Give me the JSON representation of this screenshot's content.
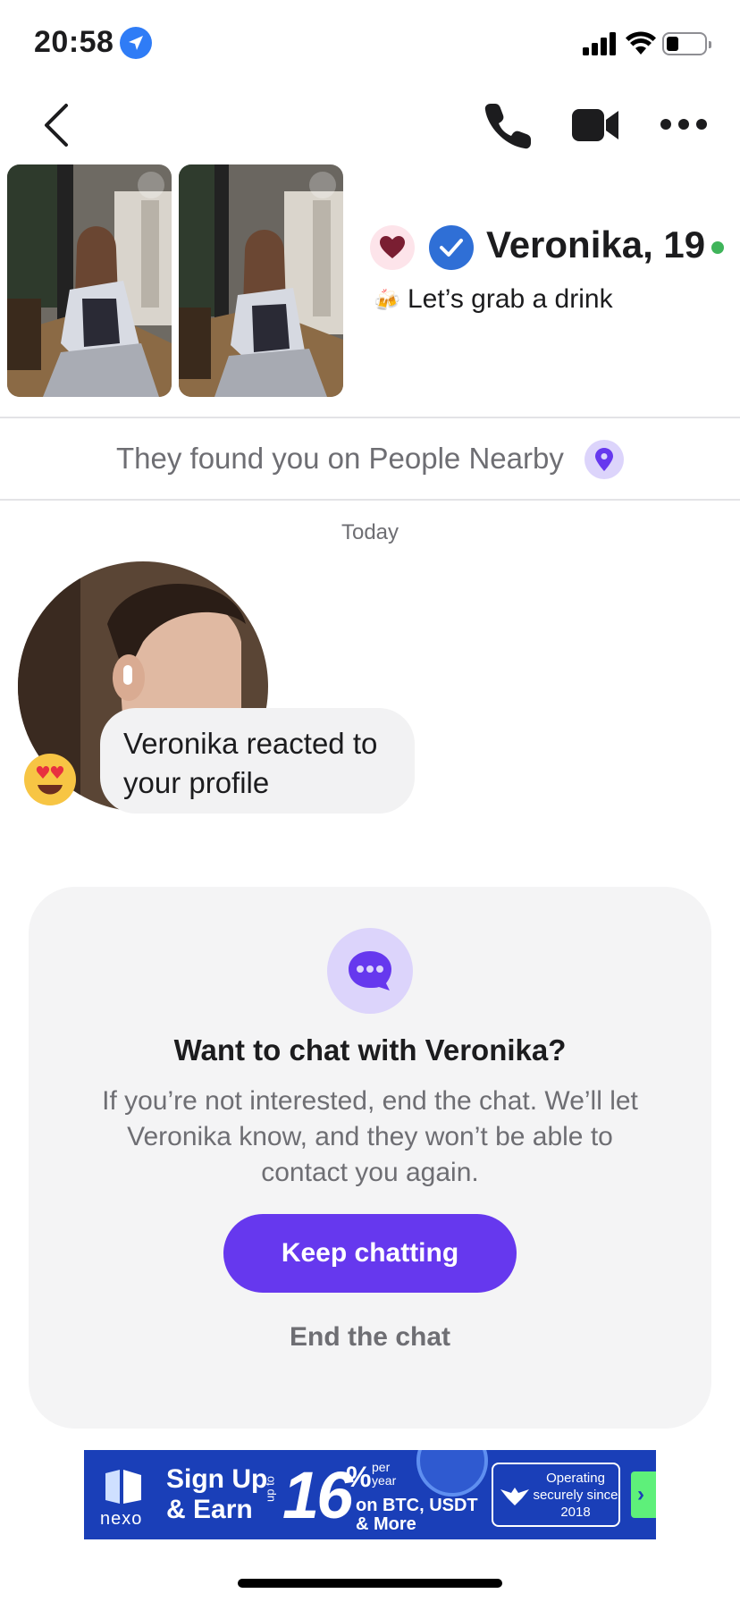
{
  "status_bar": {
    "time": "20:58",
    "icons": [
      "location-arrow-icon",
      "cellular-signal-icon",
      "wifi-icon",
      "battery-icon"
    ]
  },
  "nav": {
    "icons": [
      "chevron-left-icon",
      "phone-icon",
      "video-camera-icon",
      "ellipsis-icon"
    ]
  },
  "profile": {
    "name": "Veronika, 19",
    "status_emoji": "🍻",
    "status_text": "Let’s grab a drink",
    "online": true,
    "online_color": "#3fb45a",
    "photo_count": 2
  },
  "found_banner": {
    "text": "They found you on People Nearby"
  },
  "messages": {
    "date_label": "Today",
    "items": [
      {
        "text": "Veronika reacted to your profile",
        "reaction_emoji": "heart-eyes-emoji"
      }
    ]
  },
  "prompt": {
    "title": "Want to chat with Veronika?",
    "body": "If you’re not interested, end the chat. We’ll let Veronika know, and they won’t be able to contact you again.",
    "primary_label": "Keep chatting",
    "secondary_label": "End the chat"
  },
  "ad": {
    "brand": "nexo",
    "headline": "Sign Up & Earn",
    "up_to": "up to",
    "rate": "16",
    "percent": "%",
    "per_year": "per year",
    "assets": "on BTC, USDT & More",
    "trust": "Operating securely since 2018"
  },
  "colors": {
    "accent": "#6638ee",
    "accent_soft": "#dcd4fb",
    "verified": "#2f6fd6",
    "ad_background": "#1a3fb8"
  }
}
